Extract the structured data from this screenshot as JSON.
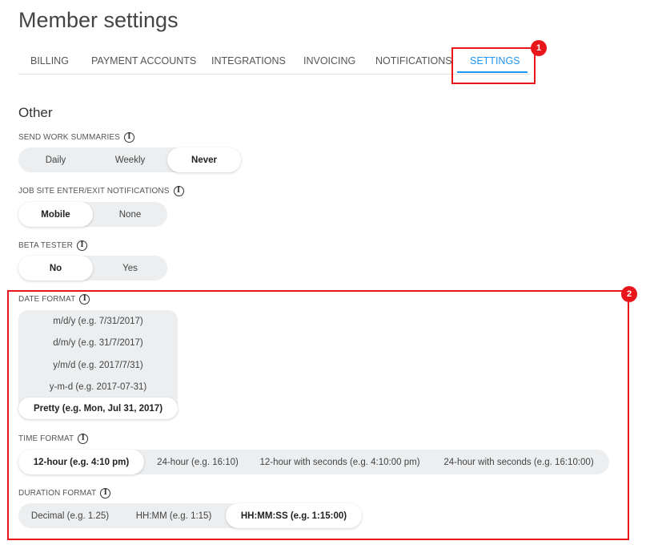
{
  "page": {
    "title": "Member settings"
  },
  "tabs": [
    {
      "label": "BILLING"
    },
    {
      "label": "PAYMENT ACCOUNTS"
    },
    {
      "label": "INTEGRATIONS"
    },
    {
      "label": "INVOICING"
    },
    {
      "label": "NOTIFICATIONS"
    },
    {
      "label": "SETTINGS",
      "active": true
    }
  ],
  "section": {
    "title": "Other"
  },
  "work_summaries": {
    "label": "SEND WORK SUMMARIES",
    "options": [
      "Daily",
      "Weekly",
      "Never"
    ],
    "selected": "Never"
  },
  "job_site": {
    "label": "JOB SITE ENTER/EXIT NOTIFICATIONS",
    "options": [
      "Mobile",
      "None"
    ],
    "selected": "Mobile"
  },
  "beta": {
    "label": "BETA TESTER",
    "options": [
      "No",
      "Yes"
    ],
    "selected": "No"
  },
  "date_format": {
    "label": "DATE FORMAT",
    "options": [
      "m/d/y (e.g. 7/31/2017)",
      "d/m/y (e.g. 31/7/2017)",
      "y/m/d (e.g. 2017/7/31)",
      "y-m-d (e.g. 2017-07-31)",
      "Pretty (e.g. Mon, Jul 31, 2017)"
    ],
    "selected": "Pretty (e.g. Mon, Jul 31, 2017)"
  },
  "time_format": {
    "label": "TIME FORMAT",
    "options": [
      "12-hour (e.g. 4:10 pm)",
      "24-hour (e.g. 16:10)",
      "12-hour with seconds (e.g. 4:10:00 pm)",
      "24-hour with seconds (e.g. 16:10:00)"
    ],
    "selected": "12-hour (e.g. 4:10 pm)"
  },
  "duration_format": {
    "label": "DURATION FORMAT",
    "options": [
      "Decimal (e.g. 1.25)",
      "HH:MM (e.g. 1:15)",
      "HH:MM:SS (e.g. 1:15:00)"
    ],
    "selected": "HH:MM:SS (e.g. 1:15:00)"
  },
  "info_icon_glyph": "i",
  "annotations": [
    {
      "number": "1",
      "color": "#e8161b"
    },
    {
      "number": "2",
      "color": "#e8161b"
    }
  ],
  "colors": {
    "accent": "#2196f3",
    "annotation": "#e8161b",
    "segment_bg": "#eceef0"
  }
}
